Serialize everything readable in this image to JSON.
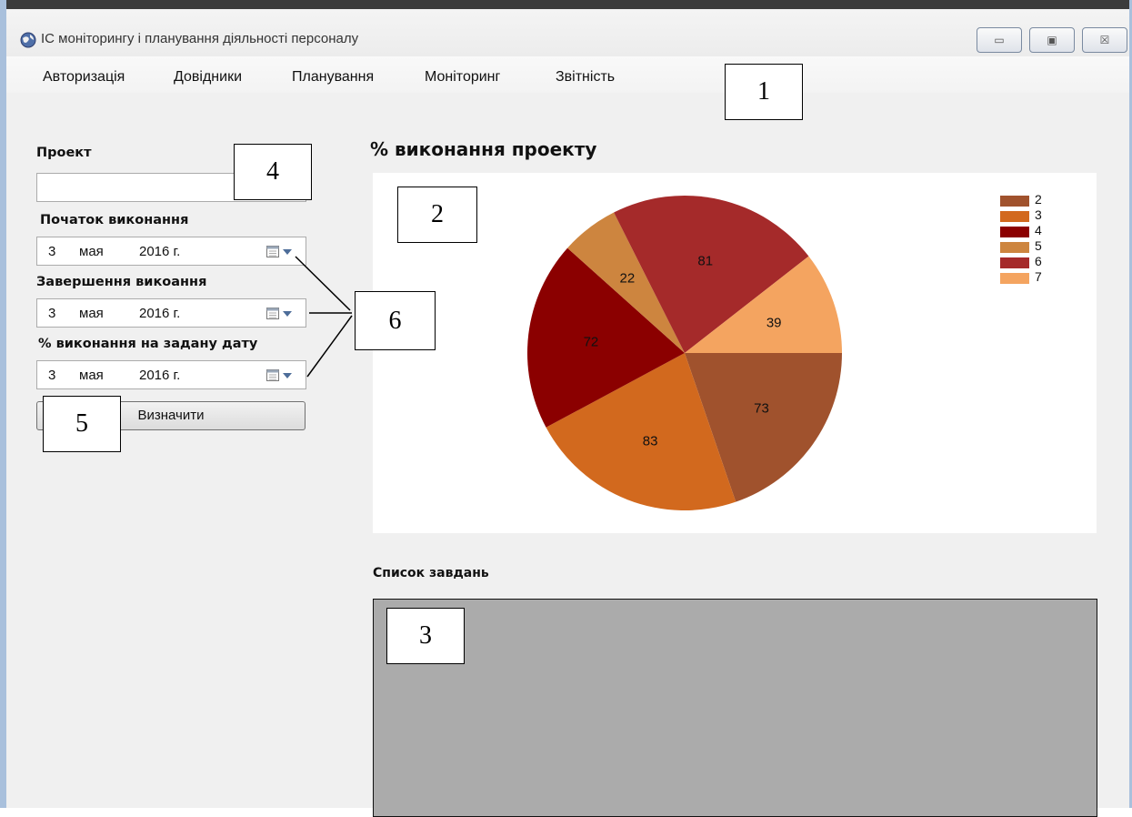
{
  "window": {
    "title": "ІС моніторингу і планування діяльності персоналу",
    "controls": {
      "minimize": "▭",
      "maximize": "▣",
      "close": "☒"
    }
  },
  "menu": {
    "items": [
      "Авторизація",
      "Довідники",
      "Планування",
      "Моніторинг",
      "Звітність"
    ]
  },
  "form": {
    "project_label": "Проект",
    "project_value": "",
    "start_label": "Початок виконання",
    "start_date": {
      "day": "3",
      "month": "мая",
      "year": "2016 г."
    },
    "end_label": "Завершення викоання",
    "end_date": {
      "day": "3",
      "month": "мая",
      "year": "2016 г."
    },
    "progress_label": "% виконання на задану дату",
    "progress_date": {
      "day": "3",
      "month": "мая",
      "year": "2016 г."
    },
    "determine_button": "Визначити"
  },
  "chart_section": {
    "title": "% виконання проекту"
  },
  "chart_data": {
    "type": "pie",
    "title": "",
    "categories": [
      "2",
      "3",
      "4",
      "5",
      "6",
      "7"
    ],
    "values": [
      73,
      83,
      72,
      22,
      81,
      39
    ],
    "colors": [
      "#a0522d",
      "#d2691e",
      "#8b0000",
      "#cd853f",
      "#a52a2a",
      "#f4a460"
    ],
    "legend_position": "top-right"
  },
  "tasks_section": {
    "title": "Список завдань"
  },
  "callouts": [
    "1",
    "2",
    "3",
    "4",
    "5",
    "6"
  ]
}
